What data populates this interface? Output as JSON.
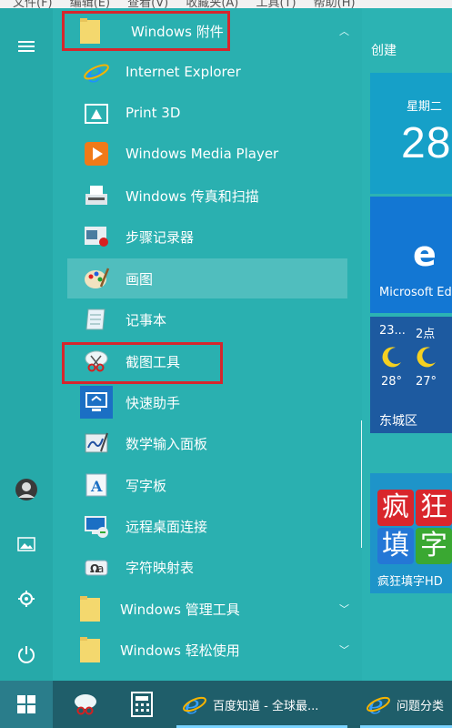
{
  "menubar": {
    "items": [
      "文件(F)",
      "编辑(E)",
      "查看(V)",
      "收藏夹(A)",
      "工具(T)",
      "帮助(H)"
    ]
  },
  "apps": {
    "folder_accessories": "Windows 附件",
    "items": [
      {
        "label": "Internet Explorer",
        "icon": "ie-icon"
      },
      {
        "label": "Print 3D",
        "icon": "print3d-icon"
      },
      {
        "label": "Windows Media Player",
        "icon": "media-player-icon"
      },
      {
        "label": "Windows 传真和扫描",
        "icon": "fax-scan-icon"
      },
      {
        "label": "步骤记录器",
        "icon": "steps-recorder-icon"
      },
      {
        "label": "画图",
        "icon": "paint-icon"
      },
      {
        "label": "记事本",
        "icon": "notepad-icon"
      },
      {
        "label": "截图工具",
        "icon": "snipping-tool-icon"
      },
      {
        "label": "快速助手",
        "icon": "quick-assist-icon"
      },
      {
        "label": "数学输入面板",
        "icon": "math-input-icon"
      },
      {
        "label": "写字板",
        "icon": "wordpad-icon"
      },
      {
        "label": "远程桌面连接",
        "icon": "remote-desktop-icon"
      },
      {
        "label": "字符映射表",
        "icon": "char-map-icon"
      }
    ],
    "folder_admin": "Windows 管理工具",
    "folder_ease": "Windows 轻松使用"
  },
  "tiles": {
    "section_title": "创建",
    "calendar": {
      "weekday": "星期二",
      "day": "28"
    },
    "edge": {
      "label": "Microsoft Ed"
    },
    "weather": {
      "t1": "23...",
      "t2": "2点",
      "low1": "28°",
      "low2": "27°",
      "location": "东城区"
    },
    "game": {
      "line1": "疯",
      "line2": "狂",
      "line3": "填",
      "line4": "字",
      "label": "疯狂填字HD"
    }
  },
  "taskbar": {
    "ie_tab1": "百度知道 - 全球最...",
    "ie_tab2": "问题分类"
  },
  "colors": {
    "accent": "#2cb3b3",
    "highlight_box": "#d6262d",
    "taskbar": "#1f5e6a"
  }
}
